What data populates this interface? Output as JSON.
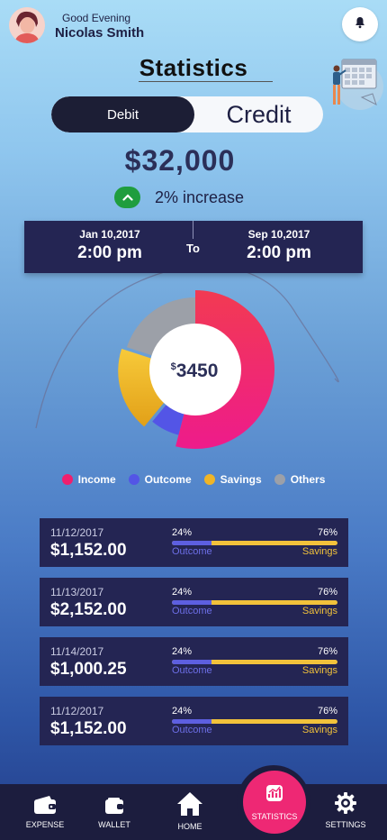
{
  "header": {
    "greeting": "Good Evening",
    "user_name": "Nicolas Smith"
  },
  "page_title": "Statistics",
  "toggle": {
    "debit_label": "Debit",
    "credit_label": "Credit",
    "selected": "Debit"
  },
  "summary": {
    "amount": "$32,000",
    "change_text": "2% increase",
    "change_direction": "up"
  },
  "date_range": {
    "from_date": "Jan 10,2017",
    "from_time": "2:00 pm",
    "to_label": "To",
    "to_date": "Sep 10,2017",
    "to_time": "2:00 pm"
  },
  "donut": {
    "center_currency": "$",
    "center_value": "3450",
    "segments": [
      {
        "name": "Income",
        "value": 54,
        "color": "#f01f6e"
      },
      {
        "name": "Outcome",
        "value": 7,
        "color": "#5355e6"
      },
      {
        "name": "Savings",
        "value": 19,
        "color": "#f0b527"
      },
      {
        "name": "Others",
        "value": 20,
        "color": "#9ca0a8"
      }
    ]
  },
  "legend": [
    {
      "label": "Income",
      "color": "#f01f6e"
    },
    {
      "label": "Outcome",
      "color": "#5355e6"
    },
    {
      "label": "Savings",
      "color": "#f0b527"
    },
    {
      "label": "Others",
      "color": "#9ca0a8"
    }
  ],
  "transactions": [
    {
      "date": "11/12/2017",
      "amount": "$1,152.00",
      "outcome_pct": "24%",
      "savings_pct": "76%",
      "outcome_fraction": 0.24,
      "outcome_label": "Outcome",
      "savings_label": "Savings"
    },
    {
      "date": "11/13/2017",
      "amount": "$2,152.00",
      "outcome_pct": "24%",
      "savings_pct": "76%",
      "outcome_fraction": 0.24,
      "outcome_label": "Outcome",
      "savings_label": "Savings"
    },
    {
      "date": "11/14/2017",
      "amount": "$1,000.25",
      "outcome_pct": "24%",
      "savings_pct": "76%",
      "outcome_fraction": 0.24,
      "outcome_label": "Outcome",
      "savings_label": "Savings"
    },
    {
      "date": "11/12/2017",
      "amount": "$1,152.00",
      "outcome_pct": "24%",
      "savings_pct": "76%",
      "outcome_fraction": 0.24,
      "outcome_label": "Outcome",
      "savings_label": "Savings"
    }
  ],
  "nav": {
    "expense": "EXPENSE",
    "wallet": "WALLET",
    "home": "HOME",
    "statistics": "STATISTICS",
    "settings": "SETTINGS",
    "active": "STATISTICS"
  },
  "colors": {
    "accent_pink": "#ee2874",
    "dark_navy": "#242553",
    "savings_yellow": "#f2c23b",
    "outcome_blue": "#5d5fe0",
    "increase_green": "#1f9d3e"
  }
}
